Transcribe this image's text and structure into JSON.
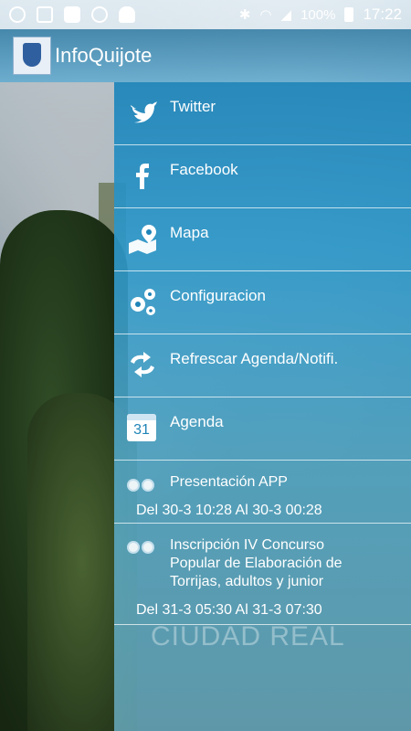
{
  "status_bar": {
    "battery": "100%",
    "time": "17:22",
    "icons": [
      "whatsapp-icon",
      "image-icon",
      "check-icon",
      "alarm-icon",
      "android-icon",
      "bluetooth-icon",
      "wifi-icon",
      "signal-icon",
      "battery-icon"
    ]
  },
  "app_bar": {
    "title": "InfoQuijote",
    "logo_icon": "coat-of-arms-icon"
  },
  "drawer": {
    "menu": [
      {
        "label": "Twitter",
        "icon": "twitter-bird-icon"
      },
      {
        "label": "Facebook",
        "icon": "facebook-f-icon"
      },
      {
        "label": "Mapa",
        "icon": "map-pin-icon"
      },
      {
        "label": "Configuracion",
        "icon": "gears-icon"
      },
      {
        "label": "Refrescar Agenda/Notifi.",
        "icon": "refresh-arrows-icon"
      },
      {
        "label": "Agenda",
        "icon": "calendar-icon"
      }
    ],
    "calendar_day": "31",
    "events": [
      {
        "title": "Presentación APP",
        "when": "Del 30-3 10:28 Al 30-3 00:28",
        "icon": "bubbles-icon"
      },
      {
        "title_lines": [
          "Inscripción IV Concurso",
          "Popular de Elaboración de",
          "Torrijas, adultos y junior"
        ],
        "when": "Del 31-3 05:30 Al 31-3 07:30",
        "icon": "bubbles-icon"
      }
    ]
  },
  "background": {
    "watermark": "CIUDAD REAL"
  },
  "colors": {
    "drawer": "#1f84b8",
    "appbar": "#1a6f9f",
    "text": "#ffffff"
  }
}
